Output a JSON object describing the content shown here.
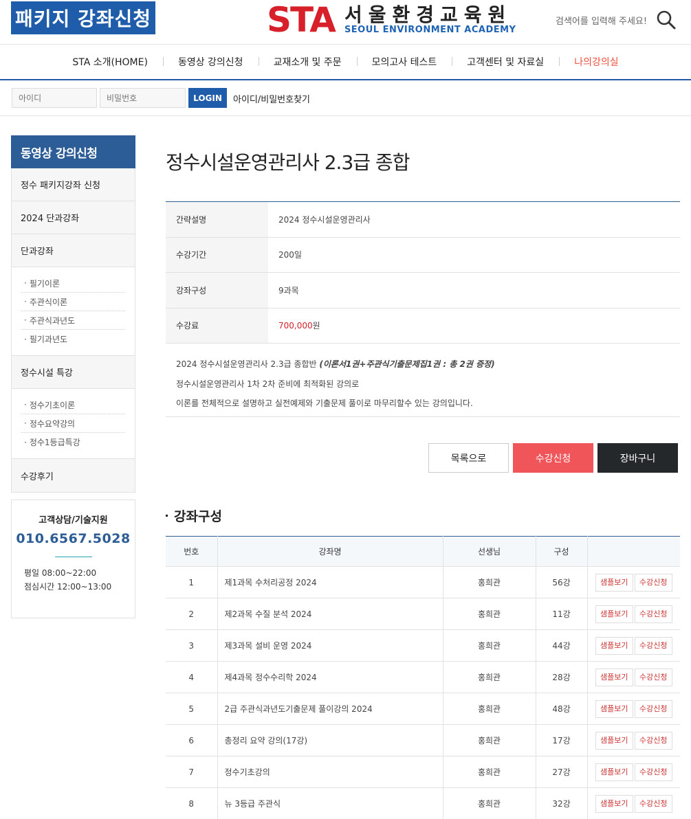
{
  "header": {
    "package_button": "패키지  강좌신청",
    "logo_sta": "STA",
    "logo_kr": "서울환경교육원",
    "logo_en": "SEOUL ENVIRONMENT ACADEMY",
    "search_placeholder": "검색어를 입력해 주세요!"
  },
  "nav": {
    "items": [
      {
        "label": "STA 소개(HOME)"
      },
      {
        "label": "동영상 강의신청"
      },
      {
        "label": "교재소개 및 주문"
      },
      {
        "label": "모의고사 테스트"
      },
      {
        "label": "고객센터 및 자료실"
      },
      {
        "label": "나의강의실"
      }
    ],
    "active_color": "#ef4e3c"
  },
  "login": {
    "id_placeholder": "아이디",
    "pw_placeholder": "비밀번호",
    "login_label": "LOGIN",
    "find_label": "아이디/비밀번호찾기"
  },
  "sidebar": {
    "title": "동영상 강의신청",
    "cat1": "정수 패키지강좌 신청",
    "cat2": "2024 단과강좌",
    "cat3": "단과강좌",
    "cat3_items": [
      "필기이론",
      "주관식이론",
      "주관식과년도",
      "필기과년도"
    ],
    "cat4": "정수시설 특강",
    "cat4_items": [
      "정수기초이론",
      "정수요약강의",
      "정수1등급특강"
    ],
    "cat5": "수강후기",
    "cs_title": "고객상담/기술지원",
    "cs_phone": "010.6567.5028",
    "cs_hours1": "평일 08:00~22:00",
    "cs_hours2": "점심시간 12:00~13:00"
  },
  "main": {
    "title": "정수시설운영관리사 2.3급 종합",
    "info": [
      {
        "label": "간략설명",
        "value": "2024 정수시설운영관리사"
      },
      {
        "label": "수강기간",
        "value": "200일"
      },
      {
        "label": "강좌구성",
        "value": "9과목"
      },
      {
        "label": "수강료",
        "price": "700,000",
        "unit": "원"
      }
    ],
    "desc_line1": "2024 정수시설운영관리사 2.3급 종합반 ",
    "desc_line1_em": "(이론서1권+주관식기출문제집1권 : 총 2권 증정)",
    "desc_line2": "정수시설운영관리사 1차 2차 준비에 최적화된 강의로",
    "desc_line3": "이론를 전체적으로 설명하고 실전예제와 기출문제 풀이로 마무리할수 있는 강의입니다.",
    "btn_list": "목록으로",
    "btn_apply": "수강신청",
    "btn_cart": "장바구니",
    "section_title": "강좌구성",
    "table_headers": {
      "no": "번호",
      "name": "강좌명",
      "teacher": "선생님",
      "count": "구성"
    },
    "sample_label": "샘플보기",
    "apply_label": "수강신청",
    "courses": [
      {
        "no": "1",
        "name": "제1과목 수처리공정 2024",
        "teacher": "홍희관",
        "count": "56강"
      },
      {
        "no": "2",
        "name": "제2과목 수질 분석 2024",
        "teacher": "홍희관",
        "count": "11강"
      },
      {
        "no": "3",
        "name": "제3과목 설비 운영 2024",
        "teacher": "홍희관",
        "count": "44강"
      },
      {
        "no": "4",
        "name": "제4과목 정수수리학 2024",
        "teacher": "홍희관",
        "count": "28강"
      },
      {
        "no": "5",
        "name": "2급 주관식과년도기출문제 풀이강의 2024",
        "teacher": "홍희관",
        "count": "48강"
      },
      {
        "no": "6",
        "name": "총정리 요약 강의(17강)",
        "teacher": "홍희관",
        "count": "17강"
      },
      {
        "no": "7",
        "name": "정수기초강의",
        "teacher": "홍희관",
        "count": "27강"
      },
      {
        "no": "8",
        "name": "뉴 3등급 주관식",
        "teacher": "홍희관",
        "count": "32강"
      }
    ]
  }
}
